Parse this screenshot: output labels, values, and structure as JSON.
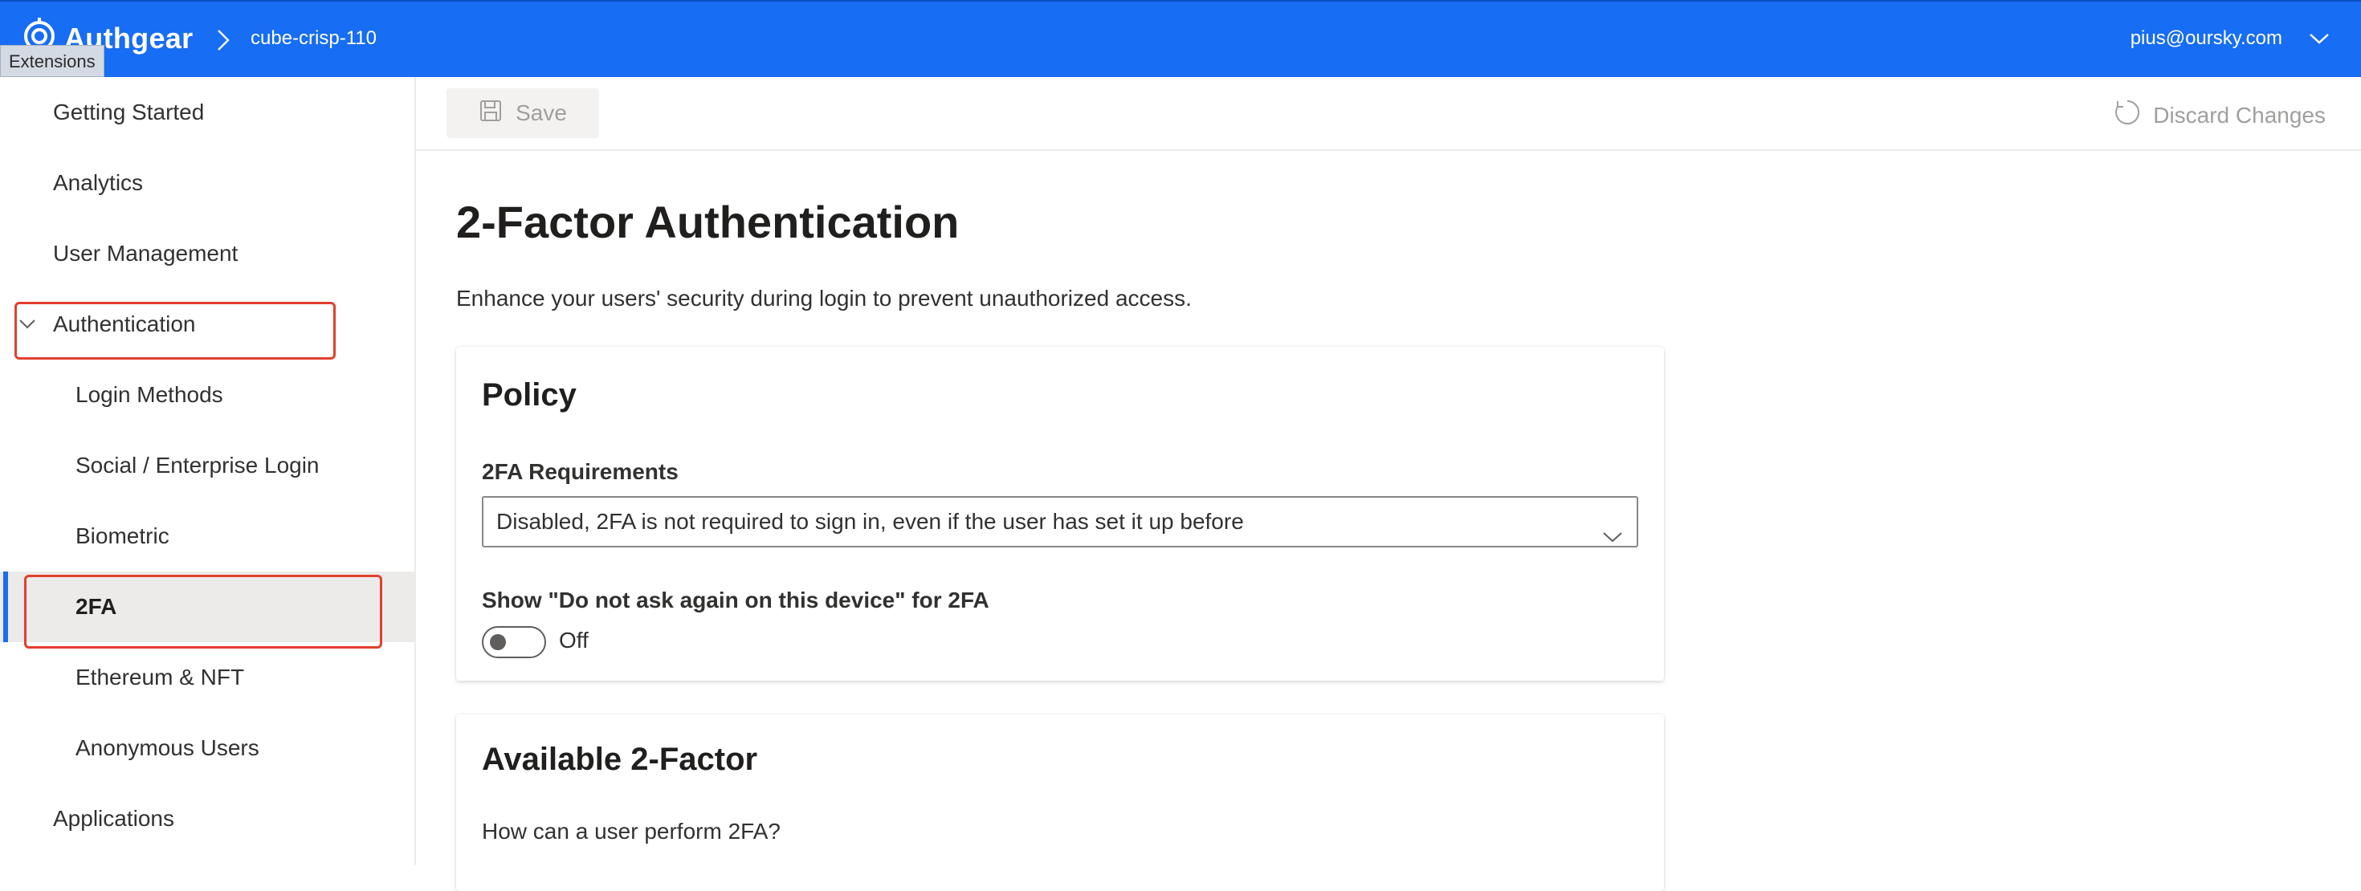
{
  "header": {
    "brand": "Authgear",
    "project": "cube-crisp-110",
    "user_email": "pius@oursky.com",
    "tooltip": "Extensions",
    "bar_color": "#176df3"
  },
  "sidebar": {
    "items": [
      {
        "label": "Getting Started"
      },
      {
        "label": "Analytics"
      },
      {
        "label": "User Management"
      },
      {
        "label": "Authentication"
      },
      {
        "label": "Login Methods"
      },
      {
        "label": "Social / Enterprise Login"
      },
      {
        "label": "Biometric"
      },
      {
        "label": "2FA"
      },
      {
        "label": "Ethereum & NFT"
      },
      {
        "label": "Anonymous Users"
      },
      {
        "label": "Applications"
      }
    ],
    "expanded_item": "Authentication",
    "selected_item": "2FA"
  },
  "toolbar": {
    "save_label": "Save",
    "discard_label": "Discard Changes"
  },
  "main": {
    "title": "2-Factor Authentication",
    "description": "Enhance your users' security during login to prevent unauthorized access.",
    "policy_card": {
      "title": "Policy",
      "requirements_label": "2FA Requirements",
      "requirements_value": "Disabled, 2FA is not required to sign in, even if the user has set it up before",
      "device_toggle_label": "Show \"Do not ask again on this device\" for 2FA",
      "device_toggle_state": "Off"
    },
    "available_card": {
      "title": "Available 2-Factor",
      "question": "How can a user perform 2FA?"
    }
  },
  "annotations": {
    "highlight_color": "#e23f2f"
  }
}
